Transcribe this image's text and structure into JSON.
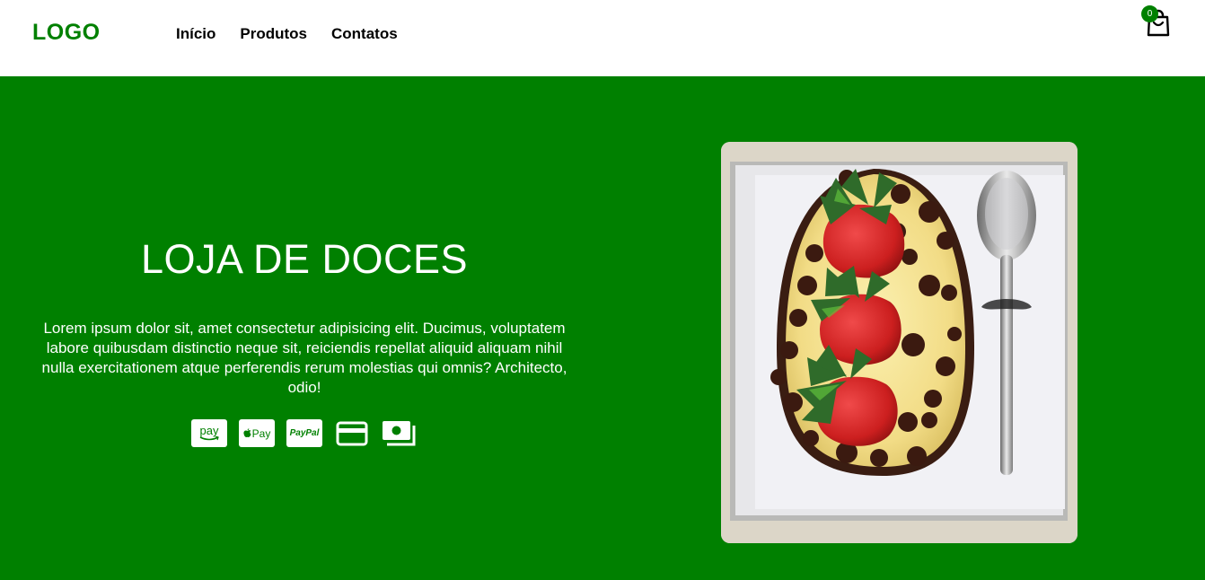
{
  "header": {
    "logo": "LOGO",
    "nav": [
      {
        "label": "Início"
      },
      {
        "label": "Produtos"
      },
      {
        "label": "Contatos"
      }
    ],
    "cart": {
      "count": "0",
      "icon": "shopping-bag-icon"
    }
  },
  "hero": {
    "title": "LOJA DE DOCES",
    "description": "Lorem ipsum dolor sit, amet consectetur adipisicing elit. Ducimus, voluptatem labore quibusdam distinctio neque sit, reiciendis repellat aliquid aliquam nihil nulla exercitationem atque perferendis rerum molestias qui omnis? Architecto, odio!",
    "payments": [
      {
        "name": "amazon-pay-icon",
        "label": "pay"
      },
      {
        "name": "apple-pay-icon",
        "label": "Pay"
      },
      {
        "name": "paypal-icon",
        "label": "PayPal"
      },
      {
        "name": "credit-card-icon"
      },
      {
        "name": "cash-icon"
      }
    ],
    "image": "strawberry-chocolate-dessert-photo"
  },
  "colors": {
    "brand": "#008000",
    "header_bg": "#ffffff",
    "text_light": "#ffffff",
    "nav_text": "#000000"
  }
}
